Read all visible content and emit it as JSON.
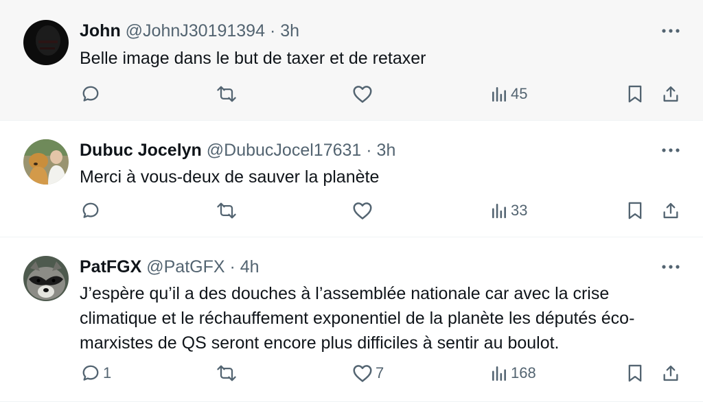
{
  "tweets": [
    {
      "name": "John",
      "handle": "@JohnJ30191394",
      "dot": "·",
      "time": "3h",
      "text": "Belle image dans le but de taxer et de retaxer",
      "avatar": "dark-avatar",
      "replies": "",
      "retweets": "",
      "likes": "",
      "views": "45"
    },
    {
      "name": "Dubuc Jocelyn",
      "handle": "@DubucJocel17631",
      "dot": "·",
      "time": "3h",
      "text": "Merci à vous-deux de sauver la planète",
      "avatar": "man-with-dog-avatar",
      "replies": "",
      "retweets": "",
      "likes": "",
      "views": "33"
    },
    {
      "name": "PatFGX",
      "handle": "@PatGFX",
      "dot": "·",
      "time": "4h",
      "text_lines": [
        "J’espère qu’il a des douches à l’assemblée nationale car avec la crise",
        "climatique et le réchauffement exponentiel de la planète les députés éco-",
        "marxistes de QS seront encore plus difficiles à sentir au boulot."
      ],
      "avatar": "raccoon-avatar",
      "replies": "1",
      "retweets": "",
      "likes": "7",
      "views": "168"
    }
  ],
  "colors": {
    "text": "#0f1419",
    "secondary": "#536471",
    "highlight_bg": "#f7f7f7",
    "divider": "#eff3f4"
  }
}
